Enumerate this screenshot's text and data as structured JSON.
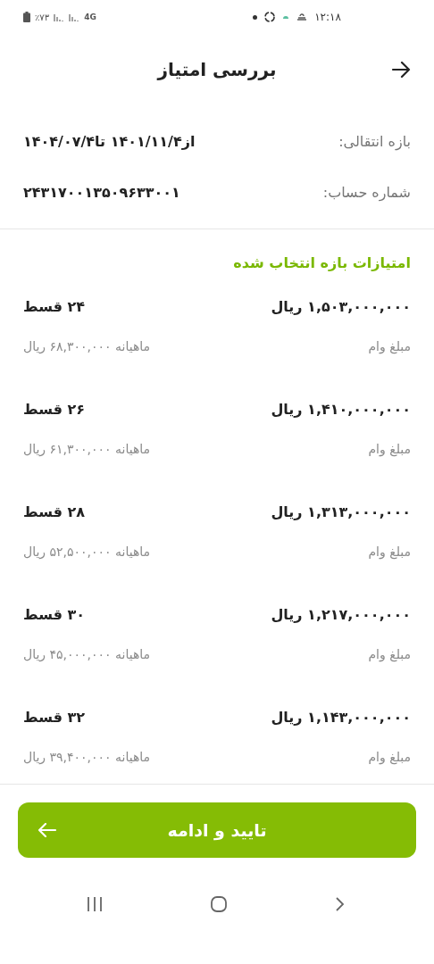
{
  "status_bar": {
    "time": "۱۲:۱۸",
    "battery": "٪۷۳",
    "network": "4G"
  },
  "header": {
    "title": "بررسی امتیاز"
  },
  "info": [
    {
      "label": "بازه انتقالی:",
      "value": "از۱۴۰۱/۱۱/۴ تا۱۴۰۴/۰۷/۴"
    },
    {
      "label": "شماره حساب:",
      "value": "۲۴۳۱۷۰۰۱۳۵۰۹۶۳۳۰۰۱"
    }
  ],
  "section_title": "امتیازات بازه انتخاب شده",
  "loans": [
    {
      "amount": "۱,۵۰۳,۰۰۰,۰۰۰ ریال",
      "installments": "۲۴ قسط",
      "label": "مبلغ وام",
      "monthly": "ماهیانه ۶۸,۳۰۰,۰۰۰ ریال"
    },
    {
      "amount": "۱,۴۱۰,۰۰۰,۰۰۰ ریال",
      "installments": "۲۶ قسط",
      "label": "مبلغ وام",
      "monthly": "ماهیانه ۶۱,۳۰۰,۰۰۰ ریال"
    },
    {
      "amount": "۱,۳۱۳,۰۰۰,۰۰۰ ریال",
      "installments": "۲۸ قسط",
      "label": "مبلغ وام",
      "monthly": "ماهیانه ۵۲,۵۰۰,۰۰۰ ریال"
    },
    {
      "amount": "۱,۲۱۷,۰۰۰,۰۰۰ ریال",
      "installments": "۳۰ قسط",
      "label": "مبلغ وام",
      "monthly": "ماهیانه ۴۵,۰۰۰,۰۰۰ ریال"
    },
    {
      "amount": "۱,۱۴۳,۰۰۰,۰۰۰ ریال",
      "installments": "۳۲ قسط",
      "label": "مبلغ وام",
      "monthly": "ماهیانه ۳۹,۴۰۰,۰۰۰ ریال"
    }
  ],
  "confirm_button": "تایید و ادامه"
}
